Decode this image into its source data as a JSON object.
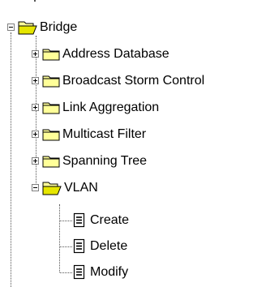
{
  "tree": {
    "root": {
      "label": "Bridge",
      "icon": "folder-open-icon",
      "expanded": true
    },
    "children": [
      {
        "label": "Address Database",
        "icon": "folder-closed-icon",
        "expanded": false
      },
      {
        "label": "Broadcast Storm Control",
        "icon": "folder-closed-icon",
        "expanded": false
      },
      {
        "label": "Link Aggregation",
        "icon": "folder-closed-icon",
        "expanded": false
      },
      {
        "label": "Multicast Filter",
        "icon": "folder-closed-icon",
        "expanded": false
      },
      {
        "label": "Spanning Tree",
        "icon": "folder-closed-icon",
        "expanded": false
      },
      {
        "label": "VLAN",
        "icon": "folder-open-icon",
        "expanded": true
      }
    ],
    "vlan_children": [
      {
        "label": "Create",
        "icon": "document-icon"
      },
      {
        "label": "Delete",
        "icon": "document-icon"
      },
      {
        "label": "Modify",
        "icon": "document-icon"
      }
    ]
  },
  "colors": {
    "folder_fill": "#FFFF99",
    "folder_fill_dark": "#E6E600",
    "folder_outline": "#000000",
    "guide_lines": "#555555",
    "document_fill": "#FFFFFF"
  }
}
